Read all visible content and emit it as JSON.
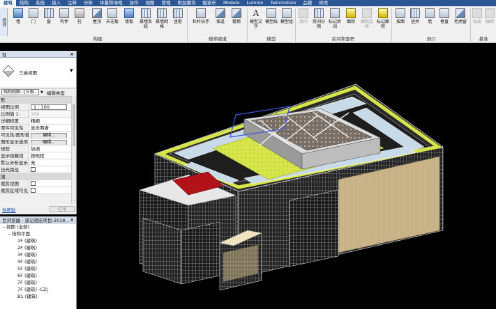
{
  "ribbon": {
    "tabs": [
      {
        "label": "建筑",
        "active": true
      },
      {
        "label": "结构"
      },
      {
        "label": "系统"
      },
      {
        "label": "插入"
      },
      {
        "label": "注释"
      },
      {
        "label": "分析"
      },
      {
        "label": "体量和场地"
      },
      {
        "label": "协作"
      },
      {
        "label": "视图"
      },
      {
        "label": "管理"
      },
      {
        "label": "附加模块"
      },
      {
        "label": "酷家乐"
      },
      {
        "label": "Modelo"
      },
      {
        "label": "Lumion"
      },
      {
        "label": "Twinmotion"
      },
      {
        "label": "品模"
      },
      {
        "label": "修改"
      }
    ],
    "modify_label": "修改",
    "tools": {
      "wall": "墙",
      "door": "门",
      "window": "窗",
      "component": "构件",
      "column": "柱",
      "roof": "屋顶",
      "ceiling": "天花板",
      "floor": "楼板",
      "curtain_system": "幕墙系统",
      "curtain_grid": "幕墙网格",
      "mullion": "竖梃",
      "railing": "栏杆扶手",
      "ramp": "坡道",
      "stair": "楼梯",
      "model_text": "模型文字",
      "model_line": "模型线",
      "model_group": "模型组",
      "room": "房间",
      "room_separator": "房间分隔",
      "tag_room": "标记房间",
      "area": "面积",
      "area_boundary": "面积边界",
      "tag_area": "标记面积",
      "by_face": "按面",
      "shaft": "竖井",
      "wall_opening": "墙",
      "vertical": "垂直",
      "dormer": "老虎窗",
      "level": "标高",
      "grid": "轴网"
    },
    "groups": {
      "build": "构建",
      "circulation": "楼梯坡道",
      "model": "模型",
      "room_area": "房间和面积",
      "opening": "洞口",
      "datum": "基准"
    }
  },
  "properties": {
    "title": "性",
    "type_name": "三维视图",
    "view_selector": "结构视图: {三维 - CZJ",
    "edit_type": "编辑类型",
    "rows": [
      {
        "kind": "section",
        "key": "形"
      },
      {
        "kind": "box",
        "key": "视图比例",
        "value": "1 : 100"
      },
      {
        "kind": "grey",
        "key": "比例值 1:",
        "value": "100"
      },
      {
        "kind": "text",
        "key": "详细程度",
        "value": "精细"
      },
      {
        "kind": "text",
        "key": "零件可见性",
        "value": "显示两者"
      },
      {
        "kind": "button",
        "key": "可见性/图形替换",
        "value": "编辑..."
      },
      {
        "kind": "button",
        "key": "图形显示选项",
        "value": "编辑..."
      },
      {
        "kind": "text",
        "key": "规程",
        "value": "协调"
      },
      {
        "kind": "text",
        "key": "显示隐藏线",
        "value": "按规程"
      },
      {
        "kind": "text",
        "key": "默认分析显示...",
        "value": "无"
      },
      {
        "kind": "check",
        "key": "日光路径",
        "value": ""
      },
      {
        "kind": "section",
        "key": "围"
      },
      {
        "kind": "check",
        "key": "裁剪视图",
        "value": ""
      },
      {
        "kind": "check",
        "key": "裁剪区域可见",
        "value": ""
      }
    ],
    "help": "性帮助",
    "apply": "应用"
  },
  "browser": {
    "title": "目浏览器 - 普记酒店项目-2018...",
    "items": [
      {
        "indent": 0,
        "toggle": "−",
        "label": "视图 (全部)"
      },
      {
        "indent": 1,
        "toggle": "−",
        "label": "结构平面"
      },
      {
        "indent": 2,
        "toggle": "",
        "label": "1F (建筑)"
      },
      {
        "indent": 2,
        "toggle": "",
        "label": "2F (建筑)"
      },
      {
        "indent": 2,
        "toggle": "",
        "label": "3F (建筑)"
      },
      {
        "indent": 2,
        "toggle": "",
        "label": "4F (建筑)"
      },
      {
        "indent": 2,
        "toggle": "",
        "label": "5F (建筑)"
      },
      {
        "indent": 2,
        "toggle": "",
        "label": "6F (建筑)"
      },
      {
        "indent": 2,
        "toggle": "",
        "label": "7F (建筑)"
      },
      {
        "indent": 2,
        "toggle": "",
        "label": "7F (建筑) -CZJ"
      },
      {
        "indent": 2,
        "toggle": "",
        "label": "B1 (建筑)"
      }
    ]
  },
  "colors": {
    "ribbon_tab_bg": "#2b5797",
    "roof_yellow": "#d6e64a",
    "roof_slab": "#c8d9e8",
    "red_canopy": "#b3121a",
    "beige_facade": "#c9b489",
    "viewport_bg": "#000000"
  }
}
